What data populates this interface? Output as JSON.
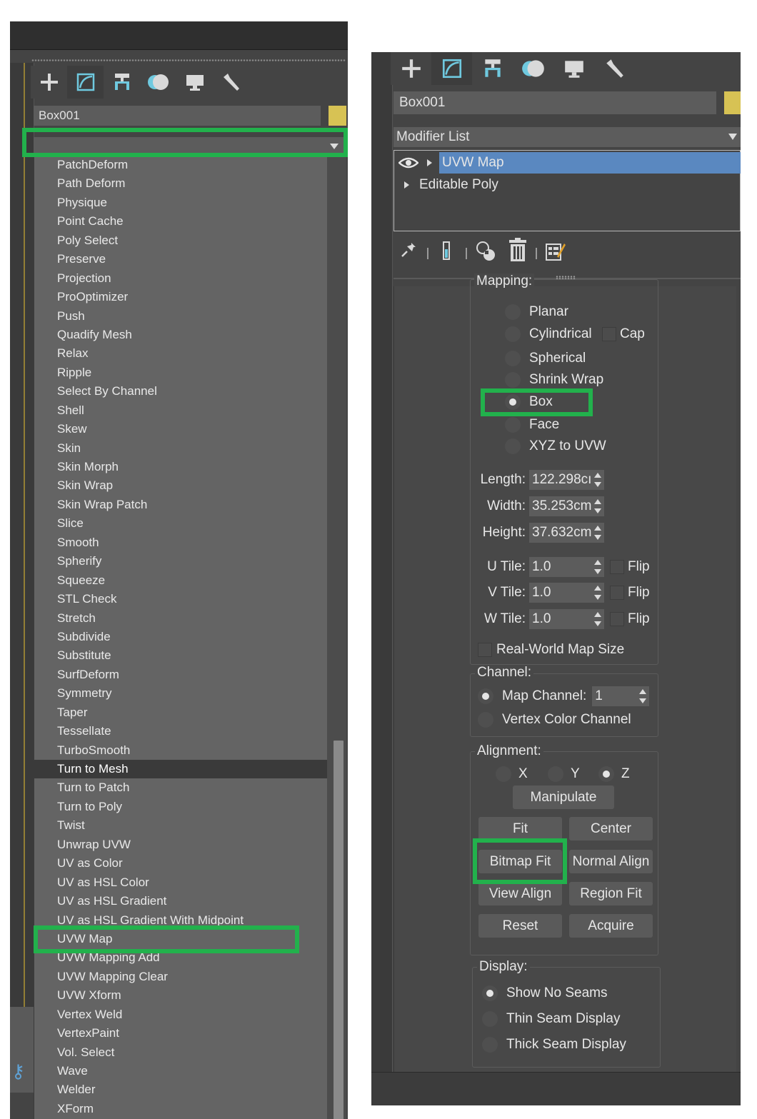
{
  "left": {
    "object_name": "Box001",
    "dropdown_value": "",
    "modifiers": [
      "PatchDeform",
      "Path Deform",
      "Physique",
      "Point Cache",
      "Poly Select",
      "Preserve",
      "Projection",
      "ProOptimizer",
      "Push",
      "Quadify Mesh",
      "Relax",
      "Ripple",
      "Select By Channel",
      "Shell",
      "Skew",
      "Skin",
      "Skin Morph",
      "Skin Wrap",
      "Skin Wrap Patch",
      "Slice",
      "Smooth",
      "Spherify",
      "Squeeze",
      "STL Check",
      "Stretch",
      "Subdivide",
      "Substitute",
      "SurfDeform",
      "Symmetry",
      "Taper",
      "Tessellate",
      "TurboSmooth",
      "Turn to Mesh",
      "Turn to Patch",
      "Turn to Poly",
      "Twist",
      "Unwrap UVW",
      "UV as Color",
      "UV as HSL Color",
      "UV as HSL Gradient",
      "UV as HSL Gradient With Midpoint",
      "UVW Map",
      "UVW Mapping Add",
      "UVW Mapping Clear",
      "UVW Xform",
      "Vertex Weld",
      "VertexPaint",
      "Vol. Select",
      "Wave",
      "Welder",
      "XForm"
    ],
    "hovered_item": "Turn to Mesh",
    "highlighted_item": "UVW Map"
  },
  "tabs": [
    "create-icon",
    "modify-icon",
    "hierarchy-icon",
    "motion-icon",
    "display-icon",
    "utilities-icon"
  ],
  "right": {
    "object_name": "Box001",
    "modifier_list_label": "Modifier List",
    "stack": [
      "UVW Map",
      "Editable Poly"
    ],
    "mapping": {
      "title_partial": "Mapping:",
      "options": [
        "Planar",
        "Cylindrical",
        "Spherical",
        "Shrink Wrap",
        "Box",
        "Face",
        "XYZ to UVW"
      ],
      "selected": "Box",
      "cap_label": "Cap",
      "length_label": "Length:",
      "length_value": "122.298cı",
      "width_label": "Width:",
      "width_value": "35.253cm",
      "height_label": "Height:",
      "height_value": "37.632cm",
      "u_tile_label": "U Tile:",
      "u_tile_value": "1.0",
      "v_tile_label": "V Tile:",
      "v_tile_value": "1.0",
      "w_tile_label": "W Tile:",
      "w_tile_value": "1.0",
      "flip_label": "Flip",
      "real_world_label": "Real-World Map Size"
    },
    "channel": {
      "title": "Channel:",
      "map_channel_label": "Map Channel:",
      "map_channel_value": "1",
      "vertex_color_label": "Vertex Color Channel",
      "selected": "Map Channel"
    },
    "alignment": {
      "title": "Alignment:",
      "axes": [
        "X",
        "Y",
        "Z"
      ],
      "selected_axis": "Z",
      "buttons": {
        "manipulate": "Manipulate",
        "fit": "Fit",
        "center": "Center",
        "bitmap_fit": "Bitmap Fit",
        "normal_align": "Normal Align",
        "view_align": "View Align",
        "region_fit": "Region Fit",
        "reset": "Reset",
        "acquire": "Acquire"
      }
    },
    "display": {
      "title": "Display:",
      "options": [
        "Show No Seams",
        "Thin Seam Display",
        "Thick Seam Display"
      ],
      "selected": "Show No Seams"
    }
  },
  "colors": {
    "panel_bg": "#444444",
    "list_bg": "#646464",
    "stack_selection": "#5a88c0",
    "object_color": "#d7c254",
    "highlight_box": "#22b14c"
  }
}
